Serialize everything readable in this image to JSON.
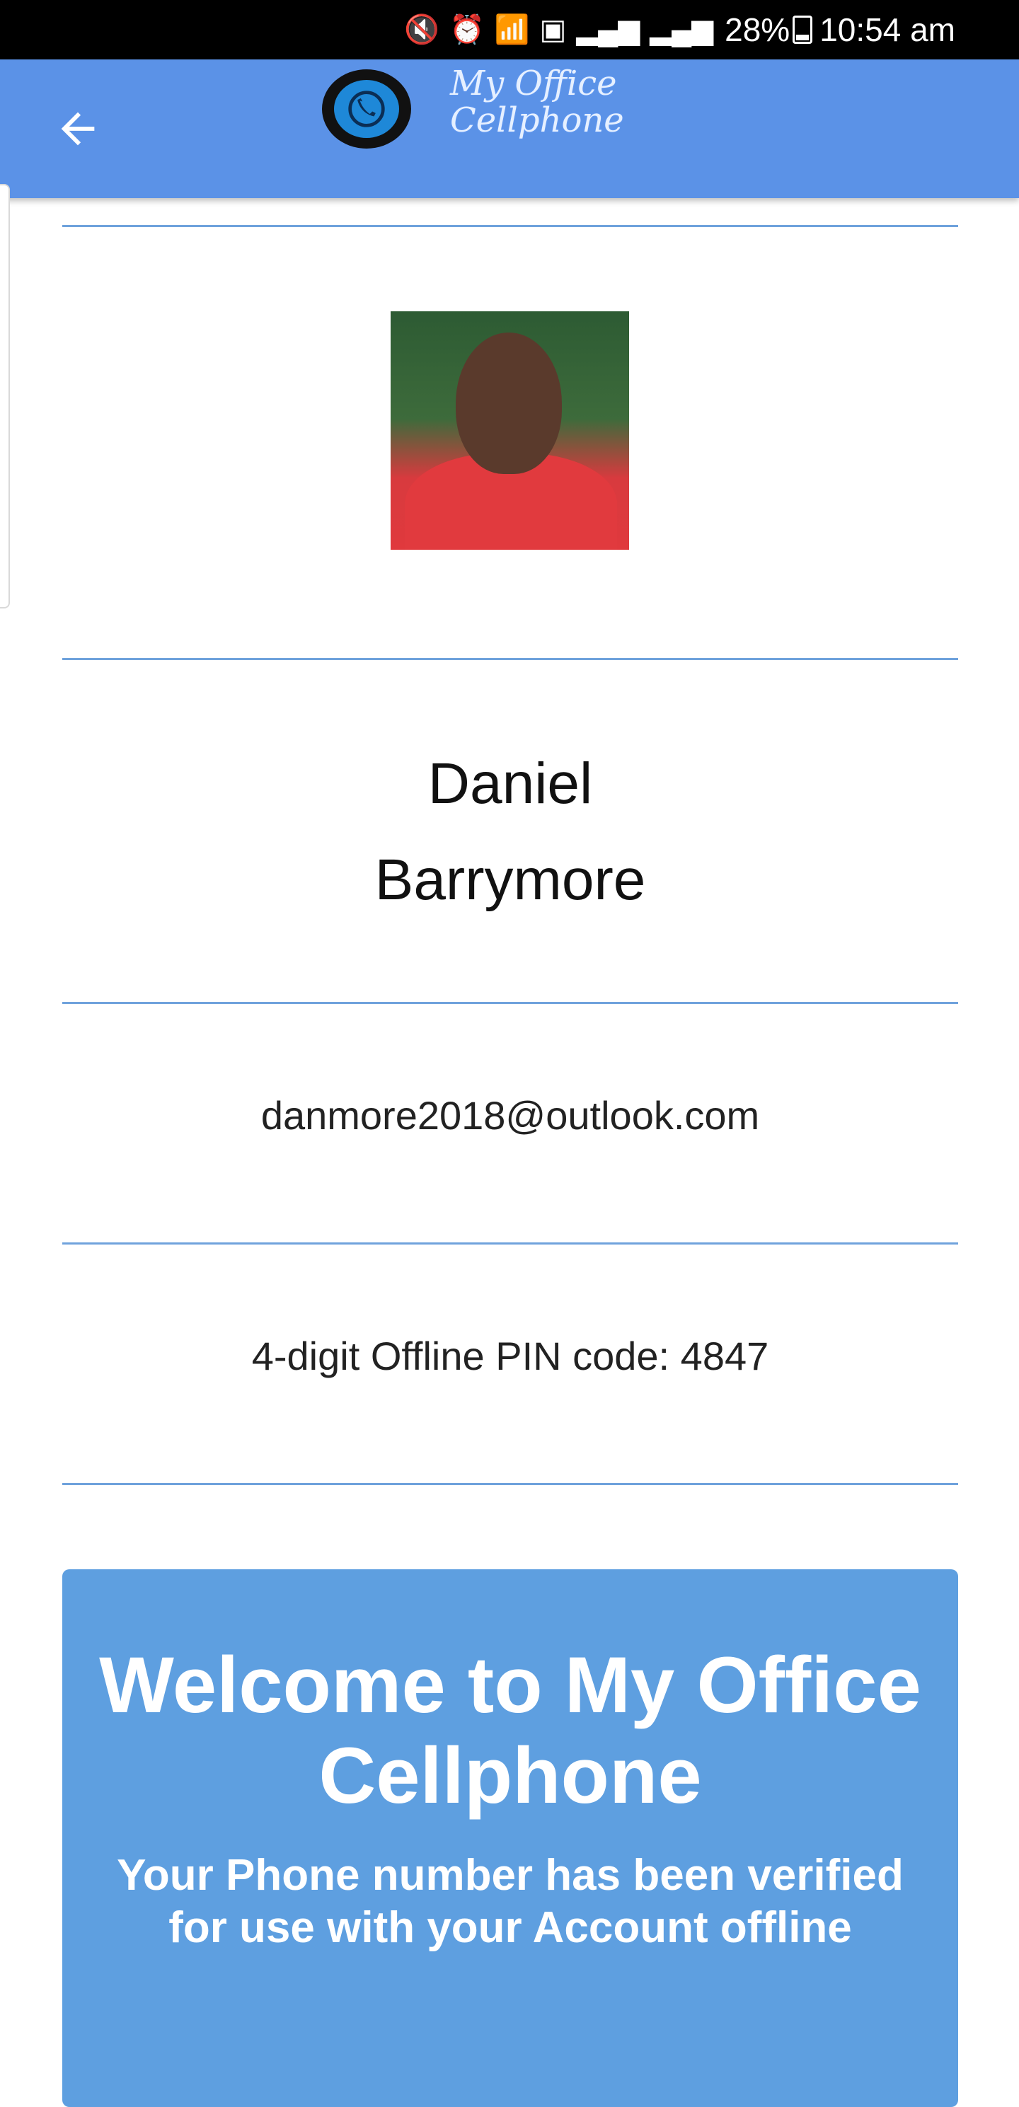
{
  "status_bar": {
    "battery": "28%",
    "time": "10:54 am",
    "icons": [
      "mute-icon",
      "alarm-icon",
      "wifi-icon",
      "sim-icon",
      "signal-icon",
      "signal-icon",
      "battery-icon"
    ]
  },
  "app_bar": {
    "back_icon": "arrow-left-icon",
    "logo_line1": "My Office",
    "logo_line2": "Cellphone",
    "color": "#5b92e7"
  },
  "profile": {
    "first_name": "Daniel",
    "last_name": "Barrymore",
    "email": "danmore2018@outlook.com",
    "pin_text": "4-digit Offline PIN code: 4847"
  },
  "welcome": {
    "title": "Welcome to My Office Cellphone",
    "subtitle": "Your Phone number has been verified for use with your Account offline",
    "color": "#5e9fe0"
  }
}
